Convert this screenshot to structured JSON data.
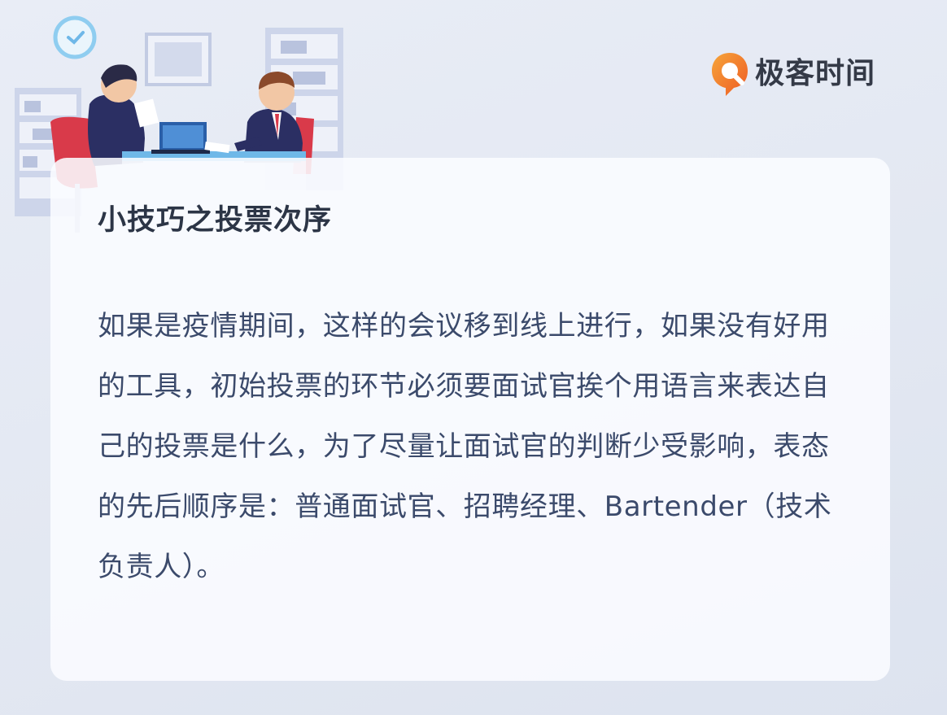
{
  "brand": {
    "name": "极客时间",
    "logo_icon": "geektime-logo-icon",
    "logo_color": "#f0782f"
  },
  "card": {
    "title": "小技巧之投票次序",
    "body": "如果是疫情期间，这样的会议移到线上进行，如果没有好用的工具，初始投票的环节必须要面试官挨个用语言来表达自己的投票是什么，为了尽量让面试官的判断少受影响，表态的先后顺序是：普通面试官、招聘经理、Bartender（技术负责人）。"
  },
  "illustration": {
    "icon": "interview-scene-illustration",
    "accent_colors": [
      "#2b2f63",
      "#d93a4a",
      "#6fb8e8",
      "#c9d3ea"
    ]
  }
}
